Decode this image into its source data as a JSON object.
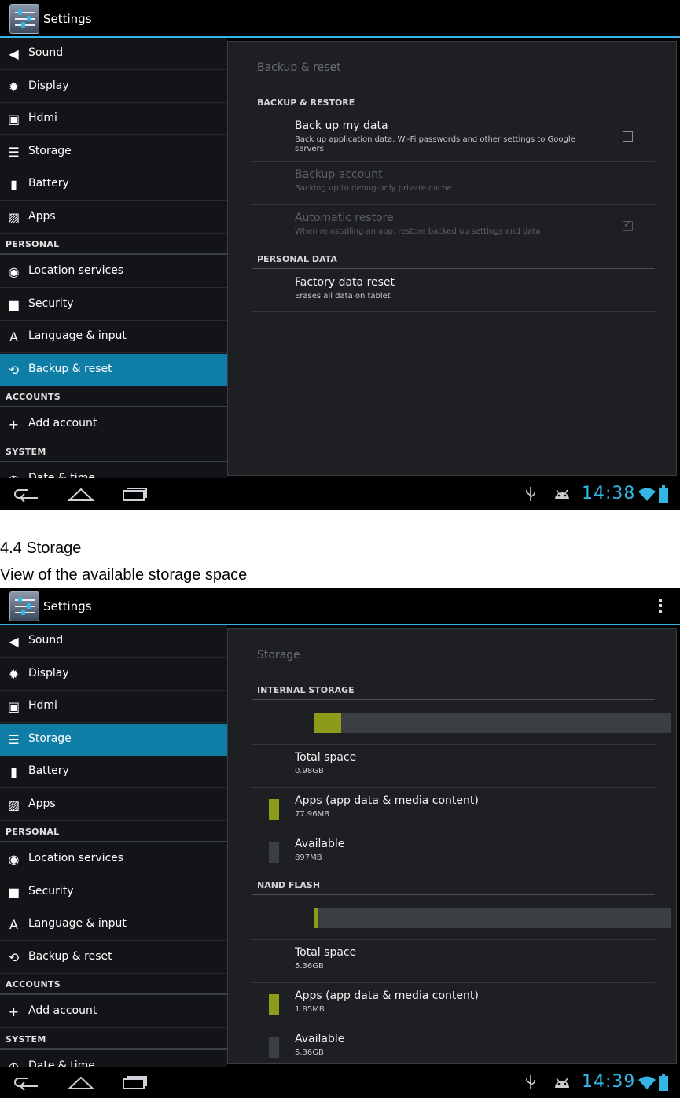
{
  "colors": {
    "accent": "#33b5e5",
    "selected": "#0e7ea6",
    "storage_apps": "#8c9c1a",
    "storage_free": "#3b3e42"
  },
  "doc": {
    "heading": "4.4 Storage",
    "subheading": "View of the available storage space"
  },
  "screen1": {
    "actionbar": {
      "title": "Settings"
    },
    "sidebar": [
      {
        "label": "Sound",
        "icon": "speaker-icon"
      },
      {
        "label": "Display",
        "icon": "brightness-icon"
      },
      {
        "label": "Hdmi",
        "icon": "hdmi-icon"
      },
      {
        "label": "Storage",
        "icon": "storage-icon"
      },
      {
        "label": "Battery",
        "icon": "battery-icon"
      },
      {
        "label": "Apps",
        "icon": "apps-icon"
      },
      {
        "header": "PERSONAL"
      },
      {
        "label": "Location services",
        "icon": "location-icon"
      },
      {
        "label": "Security",
        "icon": "lock-icon"
      },
      {
        "label": "Language & input",
        "icon": "language-icon"
      },
      {
        "label": "Backup & reset",
        "icon": "restore-icon",
        "active": true
      },
      {
        "header": "ACCOUNTS"
      },
      {
        "label": "Add account",
        "icon": "plus-icon"
      },
      {
        "header": "SYSTEM"
      },
      {
        "label": "Date & time",
        "icon": "clock-icon"
      }
    ],
    "pane": {
      "title": "Backup & reset",
      "cat_backup": "BACKUP & RESTORE",
      "backup_my_data": {
        "title": "Back up my data",
        "summary": "Back up application data, Wi-Fi passwords and other settings to Google servers",
        "checked": false
      },
      "backup_account": {
        "title": "Backup account",
        "summary": "Backing up to debug-only private cache"
      },
      "auto_restore": {
        "title": "Automatic restore",
        "summary": "When reinstalling an app, restore backed up settings and data",
        "checked": true
      },
      "cat_personal": "PERSONAL DATA",
      "factory_reset": {
        "title": "Factory data reset",
        "summary": "Erases all data on tablet"
      }
    },
    "status": {
      "time": "14:38"
    }
  },
  "screen2": {
    "actionbar": {
      "title": "Settings"
    },
    "sidebar": [
      {
        "label": "Sound",
        "icon": "speaker-icon"
      },
      {
        "label": "Display",
        "icon": "brightness-icon"
      },
      {
        "label": "Hdmi",
        "icon": "hdmi-icon"
      },
      {
        "label": "Storage",
        "icon": "storage-icon",
        "active": true
      },
      {
        "label": "Battery",
        "icon": "battery-icon"
      },
      {
        "label": "Apps",
        "icon": "apps-icon"
      },
      {
        "header": "PERSONAL"
      },
      {
        "label": "Location services",
        "icon": "location-icon"
      },
      {
        "label": "Security",
        "icon": "lock-icon"
      },
      {
        "label": "Language & input",
        "icon": "language-icon"
      },
      {
        "label": "Backup & reset",
        "icon": "restore-icon"
      },
      {
        "header": "ACCOUNTS"
      },
      {
        "label": "Add account",
        "icon": "plus-icon"
      },
      {
        "header": "SYSTEM"
      },
      {
        "label": "Date & time",
        "icon": "clock-icon"
      }
    ],
    "pane": {
      "title": "Storage",
      "internal": {
        "header": "INTERNAL STORAGE",
        "used_fraction": 0.077,
        "total": {
          "title": "Total space",
          "value": "0.98GB"
        },
        "apps": {
          "title": "Apps (app data & media content)",
          "value": "77.96MB"
        },
        "available": {
          "title": "Available",
          "value": "897MB"
        }
      },
      "nand": {
        "header": "NAND FLASH",
        "used_fraction": 0.01,
        "total": {
          "title": "Total space",
          "value": "5.36GB"
        },
        "apps": {
          "title": "Apps (app data & media content)",
          "value": "1.85MB"
        },
        "available": {
          "title": "Available",
          "value": "5.36GB"
        }
      }
    },
    "status": {
      "time": "14:39"
    }
  }
}
